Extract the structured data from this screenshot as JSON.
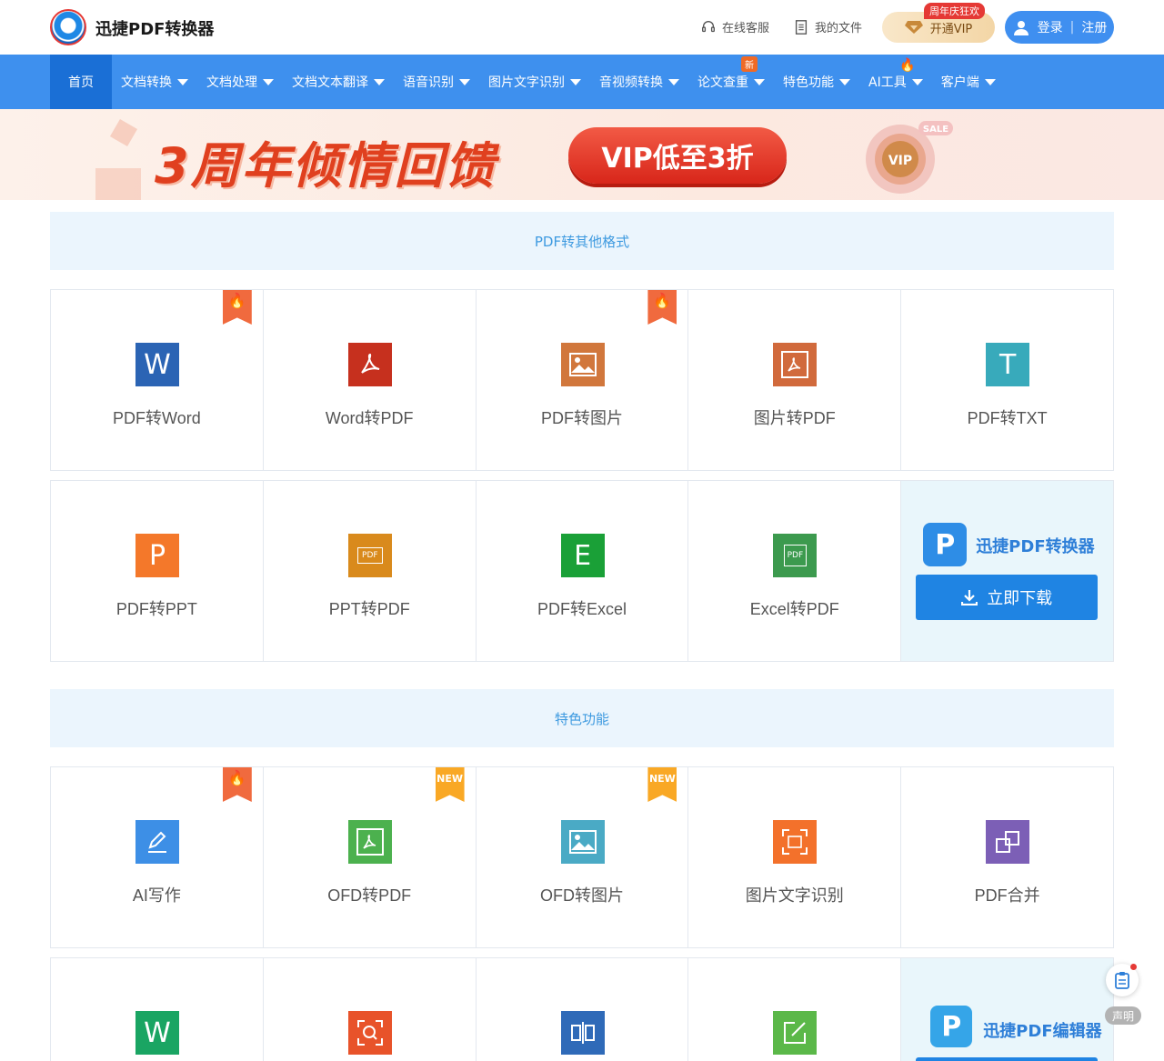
{
  "header": {
    "brand": "迅捷PDF转换器",
    "service": "在线客服",
    "files": "我的文件",
    "vip_badge": "周年庆狂欢",
    "vip": "开通VIP",
    "login": "登录",
    "register": "注册"
  },
  "nav": {
    "home": "首页",
    "items": [
      {
        "label": "文档转换"
      },
      {
        "label": "文档处理"
      },
      {
        "label": "文档文本翻译"
      },
      {
        "label": "语音识别"
      },
      {
        "label": "图片文字识别"
      },
      {
        "label": "音视频转换"
      },
      {
        "label": "论文查重",
        "badge": "新"
      },
      {
        "label": "特色功能"
      },
      {
        "label": "AI工具"
      },
      {
        "label": "客户端"
      }
    ]
  },
  "banner": {
    "title": "3周年倾情回馈",
    "pill": "VIP低至3折",
    "medal_vip": "VIP",
    "medal_sale": "SALE"
  },
  "section1": {
    "title": "PDF转其他格式",
    "row1": [
      "PDF转Word",
      "Word转PDF",
      "PDF转图片",
      "图片转PDF",
      "PDF转TXT"
    ],
    "row2": [
      "PDF转PPT",
      "PPT转PDF",
      "PDF转Excel",
      "Excel转PDF"
    ],
    "promo_name": "迅捷PDF转换器",
    "promo_btn": "立即下载"
  },
  "section2": {
    "title": "特色功能",
    "row1": [
      "AI写作",
      "OFD转PDF",
      "OFD转图片",
      "图片文字识别",
      "PDF合并"
    ],
    "promo_name": "迅捷PDF编辑器"
  },
  "ribbons": {
    "new": "NEW"
  },
  "icon_letters": {
    "word": "W",
    "ppt": "P",
    "excel": "E",
    "txt": "T",
    "pdf": "PDF"
  },
  "float": {
    "label": "声明"
  },
  "colors": {
    "nav": "#3e90ee",
    "nav_active": "#1a6fd6",
    "accent": "#1f84e3",
    "section_bg": "#ebf5fd"
  }
}
